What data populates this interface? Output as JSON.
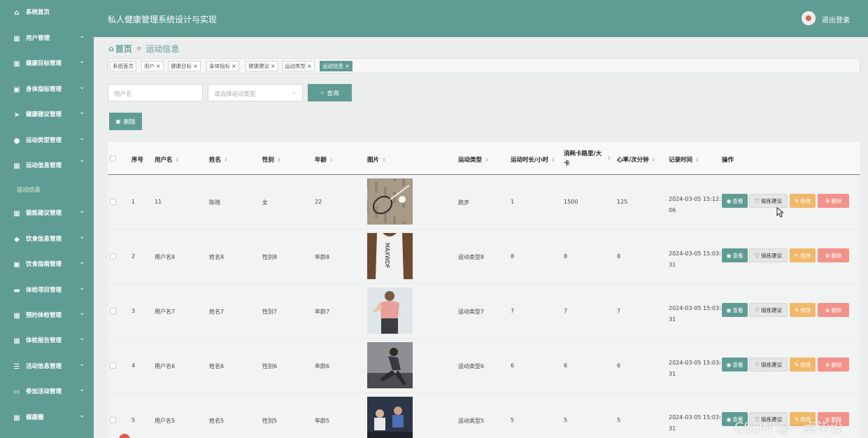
{
  "header": {
    "app_title": "私人健康管理系统设计与实现",
    "logout_label": "退出登录"
  },
  "sidebar": {
    "items": [
      {
        "label": "系统首页",
        "icon": "home-icon",
        "glyph": "⌂",
        "chevron": ""
      },
      {
        "label": "用户管理",
        "icon": "grid-icon",
        "glyph": "▦",
        "chevron": "⌄"
      },
      {
        "label": "健康目标管理",
        "icon": "grid-icon",
        "glyph": "▦",
        "chevron": "⌄"
      },
      {
        "label": "身体指标管理",
        "icon": "clipboard-icon",
        "glyph": "▣",
        "chevron": "⌄"
      },
      {
        "label": "健康建议管理",
        "icon": "send-icon",
        "glyph": "➤",
        "chevron": "⌄"
      },
      {
        "label": "运动类型管理",
        "icon": "user-icon",
        "glyph": "●",
        "chevron": "⌄"
      },
      {
        "label": "运动信息管理",
        "icon": "grid-icon",
        "glyph": "▦",
        "chevron": "⌃"
      },
      {
        "label": "锻炼建议管理",
        "icon": "grid-icon",
        "glyph": "▦",
        "chevron": "⌄"
      },
      {
        "label": "饮食信息管理",
        "icon": "location-icon",
        "glyph": "◆",
        "chevron": "⌄"
      },
      {
        "label": "饮食指南管理",
        "icon": "clipboard-icon",
        "glyph": "▣",
        "chevron": "⌄"
      },
      {
        "label": "体检项目管理",
        "icon": "chat-icon",
        "glyph": "▬",
        "chevron": "⌄"
      },
      {
        "label": "预约体检管理",
        "icon": "grid-icon",
        "glyph": "▦",
        "chevron": "⌄"
      },
      {
        "label": "体检报告管理",
        "icon": "grid-icon",
        "glyph": "▦",
        "chevron": "⌄"
      },
      {
        "label": "活动信息管理",
        "icon": "list-icon",
        "glyph": "☰",
        "chevron": "⌄"
      },
      {
        "label": "参加活动管理",
        "icon": "briefcase-icon",
        "glyph": "▭",
        "chevron": "⌄"
      },
      {
        "label": "健康圈",
        "icon": "grid-icon",
        "glyph": "▦",
        "chevron": "⌄"
      }
    ],
    "submenu_label": "运动信息"
  },
  "breadcrumb": {
    "home": "首页",
    "separator": "≡",
    "current": "运动信息"
  },
  "tags": [
    {
      "label": "系统首页",
      "closable": ""
    },
    {
      "label": "用户",
      "closable": "×"
    },
    {
      "label": "健康目标",
      "closable": "×"
    },
    {
      "label": "身体指标",
      "closable": "×"
    },
    {
      "label": "健康建议",
      "closable": "×"
    },
    {
      "label": "运动类型",
      "closable": "×"
    },
    {
      "label": "运动信息",
      "closable": "×"
    }
  ],
  "search": {
    "username_placeholder": "用户名",
    "type_placeholder": "请选择运动类型",
    "button_label": "查询"
  },
  "toolbar": {
    "delete_label": "删除"
  },
  "table": {
    "columns": {
      "index": "序号",
      "username": "用户名",
      "name": "姓名",
      "gender": "性别",
      "age": "年龄",
      "image": "图片",
      "type": "运动类型",
      "duration": "运动时长/小时",
      "calories": "消耗卡路里/大卡",
      "heart_rate": "心率/次分钟",
      "time": "记录时间",
      "actions": "操作"
    },
    "sort_glyph": "⇕",
    "rows": [
      {
        "index": "1",
        "username": "11",
        "name": "陈晓",
        "gender": "女",
        "age": "22",
        "type": "跑步",
        "duration": "1",
        "calories": "1500",
        "heart_rate": "125",
        "time": "2024-03-05 15:12:06"
      },
      {
        "index": "2",
        "username": "用户名8",
        "name": "姓名8",
        "gender": "性别8",
        "age": "年龄8",
        "type": "运动类型8",
        "duration": "8",
        "calories": "8",
        "heart_rate": "8",
        "time": "2024-03-05 15:03:31"
      },
      {
        "index": "3",
        "username": "用户名7",
        "name": "姓名7",
        "gender": "性别7",
        "age": "年龄7",
        "type": "运动类型7",
        "duration": "7",
        "calories": "7",
        "heart_rate": "7",
        "time": "2024-03-05 15:03:31"
      },
      {
        "index": "4",
        "username": "用户名6",
        "name": "姓名6",
        "gender": "性别6",
        "age": "年龄6",
        "type": "运动类型6",
        "duration": "6",
        "calories": "6",
        "heart_rate": "6",
        "time": "2024-03-05 15:03:31"
      },
      {
        "index": "5",
        "username": "用户名5",
        "name": "姓名5",
        "gender": "性别5",
        "age": "年龄5",
        "type": "运动类型5",
        "duration": "5",
        "calories": "5",
        "heart_rate": "5",
        "time": "2024-03-05 15:03:31"
      }
    ],
    "actions": {
      "view": "查看",
      "advice": "锻炼建议",
      "edit": "修改",
      "delete": "删除"
    }
  },
  "watermark": "CSDN @一点毕设"
}
